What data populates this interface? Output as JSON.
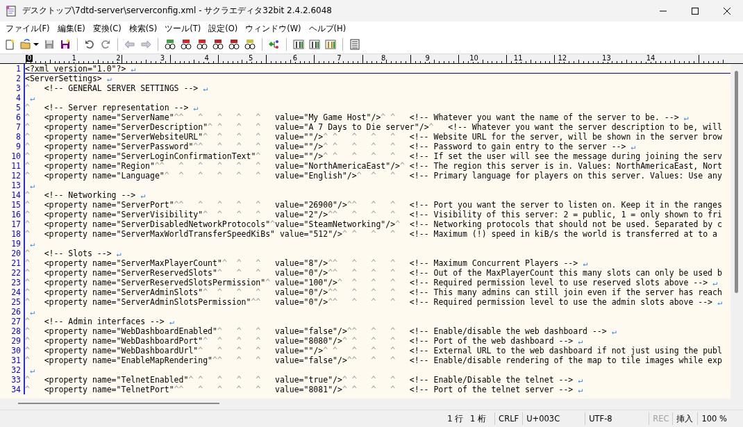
{
  "window": {
    "title": "デスクトップ\\7dtd-server\\serverconfig.xml - サクラエディタ32bit 2.4.2.6048"
  },
  "menu": [
    "ファイル(F)",
    "編集(E)",
    "変換(C)",
    "検索(S)",
    "ツール(T)",
    "設定(O)",
    "ウィンドウ(W)",
    "ヘルプ(H)"
  ],
  "ruler": {
    "labels": [
      {
        "text": "0",
        "selected": true
      },
      {
        "text": "1",
        "selected": false
      },
      {
        "text": "2",
        "selected": false
      },
      {
        "text": "3",
        "selected": false
      },
      {
        "text": "4",
        "selected": false
      },
      {
        "text": "5",
        "selected": false
      },
      {
        "text": "6",
        "selected": false
      },
      {
        "text": "7",
        "selected": false
      },
      {
        "text": "8",
        "selected": false
      },
      {
        "text": "9",
        "selected": false
      },
      {
        "text": "10",
        "selected": false
      },
      {
        "text": "11",
        "selected": false
      },
      {
        "text": "12",
        "selected": false
      },
      {
        "text": "13",
        "selected": false
      },
      {
        "text": "14",
        "selected": false
      }
    ]
  },
  "editor": {
    "tab_mark": "^",
    "eol_mark": "↵",
    "lines": [
      {
        "number": "1",
        "text": "<?xml version=\"1.0\"?>",
        "eol": true,
        "selected": true
      },
      {
        "number": "2",
        "text": "<ServerSettings>",
        "eol": true,
        "selected": false
      },
      {
        "number": "3",
        "text": "\t<!-- GENERAL SERVER SETTINGS -->",
        "eol": true,
        "selected": false
      },
      {
        "number": "4",
        "eol": true,
        "selected": false
      },
      {
        "number": "5",
        "text": "\t<!-- Server representation -->",
        "eol": true,
        "selected": false
      },
      {
        "number": "6",
        "text": "\t<property name=\"ServerName\"\t\t\t\t\t\tvalue=\"My Game Host\"/>\t\t<!-- Whatever you want the name of the server to be. -->",
        "eol": true,
        "selected": false
      },
      {
        "number": "7",
        "text": "\t<property name=\"ServerDescription\"\t\t\t\tvalue=\"A 7 Days to Die server\"/>\t<!-- Whatever you want the server description to be, will",
        "eol": false,
        "selected": false
      },
      {
        "number": "8",
        "text": "\t<property name=\"ServerWebsiteURL\"\t\t\t\tvalue=\"\"/>\t\t\t\t\t<!-- Website URL for the server, will be shown in the server brow",
        "eol": false,
        "selected": false
      },
      {
        "number": "9",
        "text": "\t<property name=\"ServerPassword\"\t\t\t\t\tvalue=\"\"/>\t\t\t\t\t<!-- Password to gain entry to the server -->",
        "eol": true,
        "selected": false
      },
      {
        "number": "10",
        "text": "\t<property name=\"ServerLoginConfirmationText\"\tvalue=\"\"/>\t\t\t\t\t<!-- If set the user will see the message during joining the serv",
        "eol": false,
        "selected": false
      },
      {
        "number": "11",
        "text": "\t<property name=\"Region\"\t\t\t\t\t\t\tvalue=\"NorthAmericaEast\"/>\t<!-- The region this server is in. Values: NorthAmericaEast, Nort",
        "eol": false,
        "selected": false
      },
      {
        "number": "12",
        "text": "\t<property name=\"Language\"\t\t\t\t\t\tvalue=\"English\"/>\t\t\t<!-- Primary language for players on this server. Values: Use any",
        "eol": false,
        "selected": false
      },
      {
        "number": "13",
        "eol": true,
        "selected": false
      },
      {
        "number": "14",
        "text": "\t<!-- Networking -->",
        "eol": true,
        "selected": false
      },
      {
        "number": "15",
        "text": "\t<property name=\"ServerPort\"\t\t\t\t\t\tvalue=\"26900\"/>\t\t\t\t<!-- Port you want the server to listen on. Keep it in the ranges",
        "eol": false,
        "selected": false
      },
      {
        "number": "16",
        "text": "\t<property name=\"ServerVisibility\"\t\t\t\tvalue=\"2\"/>\t\t\t\t\t<!-- Visibility of this server: 2 = public, 1 = only shown to fri",
        "eol": false,
        "selected": false
      },
      {
        "number": "17",
        "text": "\t<property name=\"ServerDisabledNetworkProtocols\"\tvalue=\"SteamNetworking\"/>\t<!-- Networking protocols that should not be used. Separated by c",
        "eol": false,
        "selected": false
      },
      {
        "number": "18",
        "text": "\t<property name=\"ServerMaxWorldTransferSpeedKiBs\" value=\"512\"/>\t\t\t\t<!-- Maximum (!) speed in kiB/s the world is transferred at to a",
        "eol": false,
        "selected": false
      },
      {
        "number": "19",
        "eol": true,
        "selected": false
      },
      {
        "number": "20",
        "text": "\t<!-- Slots -->",
        "eol": true,
        "selected": false
      },
      {
        "number": "21",
        "text": "\t<property name=\"ServerMaxPlayerCount\"\t\t\tvalue=\"8\"/>\t\t\t\t\t<!-- Maximum Concurrent Players -->",
        "eol": true,
        "selected": false
      },
      {
        "number": "22",
        "text": "\t<property name=\"ServerReservedSlots\"\t\t\tvalue=\"0\"/>\t\t\t\t\t<!-- Out of the MaxPlayerCount this many slots can only be used b",
        "eol": false,
        "selected": false
      },
      {
        "number": "23",
        "text": "\t<property name=\"ServerReservedSlotsPermission\"\tvalue=\"100\"/>\t\t\t\t<!-- Required permission level to use reserved slots above -->",
        "eol": true,
        "selected": false
      },
      {
        "number": "24",
        "text": "\t<property name=\"ServerAdminSlots\"\t\t\t\tvalue=\"0\"/>\t\t\t\t\t<!-- This many admins can still join even if the server has reach",
        "eol": false,
        "selected": false
      },
      {
        "number": "25",
        "text": "\t<property name=\"ServerAdminSlotsPermission\"\t\tvalue=\"0\"/>\t\t\t\t\t<!-- Required permission level to use the admin slots above -->",
        "eol": true,
        "selected": false
      },
      {
        "number": "26",
        "eol": true,
        "selected": false
      },
      {
        "number": "27",
        "text": "\t<!-- Admin interfaces -->",
        "eol": true,
        "selected": false
      },
      {
        "number": "28",
        "text": "\t<property name=\"WebDashboardEnabled\"\t\t\tvalue=\"false\"/>\t\t\t\t<!-- Enable/disable the web dashboard -->",
        "eol": true,
        "selected": false
      },
      {
        "number": "29",
        "text": "\t<property name=\"WebDashboardPort\"\t\t\t\tvalue=\"8080\"/>\t\t\t\t<!-- Port of the web dashboard -->",
        "eol": true,
        "selected": false
      },
      {
        "number": "30",
        "text": "\t<property name=\"WebDashboardUrl\"\t\t\t\tvalue=\"\"/>\t\t\t\t\t<!-- External URL to the web dashboard if not just using the publ",
        "eol": false,
        "selected": false
      },
      {
        "number": "31",
        "text": "\t<property name=\"EnableMapRendering\"\t\t\t\tvalue=\"false\"/>\t\t\t\t<!-- Enable/disable rendering of the map to tile images while exp",
        "eol": false,
        "selected": false
      },
      {
        "number": "32",
        "eol": true,
        "selected": false
      },
      {
        "number": "33",
        "text": "\t<property name=\"TelnetEnabled\"\t\t\t\t\tvalue=\"true\"/>\t\t\t\t<!-- Enable/Disable the telnet -->",
        "eol": true,
        "selected": false
      },
      {
        "number": "34",
        "text": "\t<property name=\"TelnetPort\"\t\t\t\t\t\tvalue=\"8081\"/>\t\t\t\t<!-- Port of the telnet server -->",
        "eol": true,
        "selected": false
      }
    ]
  },
  "status_bar": [
    {
      "text": "1 行",
      "disabled": false
    },
    {
      "text": "1 桁",
      "disabled": false
    },
    {
      "text": "CRLF",
      "disabled": false
    },
    {
      "text": "U+003C",
      "disabled": false
    },
    {
      "text": "UTF-8",
      "disabled": false
    },
    {
      "text": "REC",
      "disabled": true
    },
    {
      "text": "挿入",
      "disabled": false
    },
    {
      "text": "100 %",
      "disabled": false
    }
  ]
}
